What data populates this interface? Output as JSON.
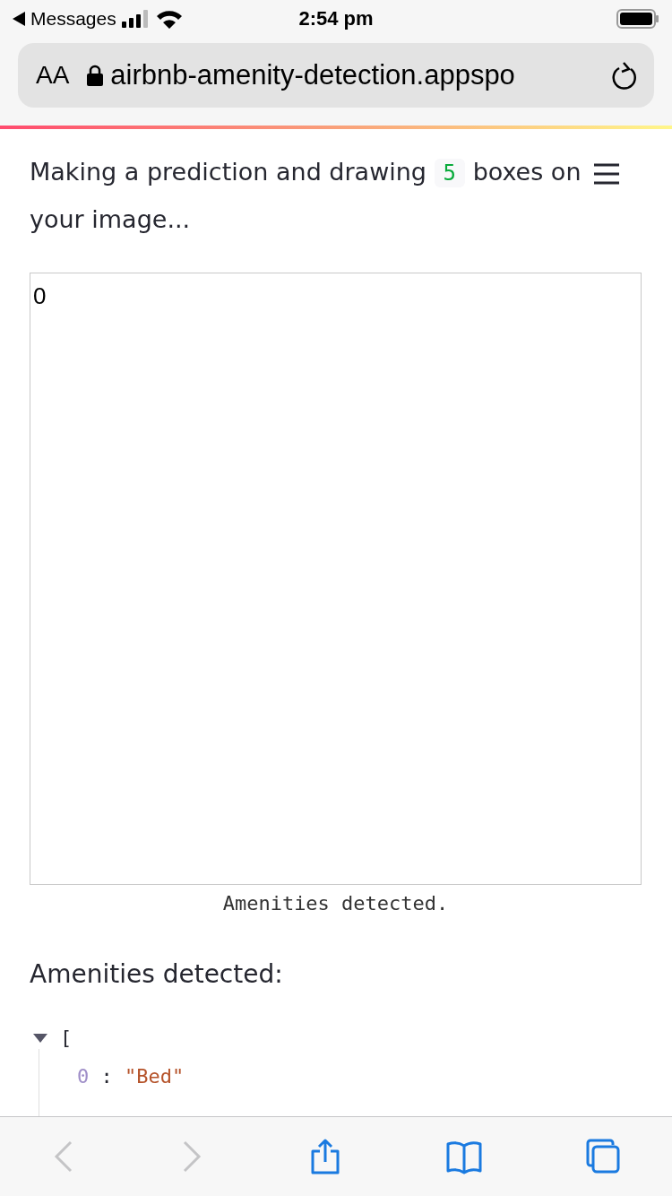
{
  "status_bar": {
    "back_label": "Messages",
    "time": "2:54 pm"
  },
  "address_bar": {
    "text_size": "AA",
    "url": "airbnb-amenity-detection.appspo"
  },
  "content": {
    "message_before": "Making a prediction and drawing",
    "count": "5",
    "message_after": "boxes on your image...",
    "image_label": "0",
    "caption": "Amenities detected.",
    "heading": "Amenities detected:",
    "json_tree": {
      "bracket": "[",
      "expanded": true,
      "items": [
        {
          "index": "0",
          "separator": ":",
          "value": "\"Bed\""
        }
      ]
    }
  },
  "toolbar": {
    "buttons": [
      {
        "kind": "back",
        "disabled": true
      },
      {
        "kind": "forward",
        "disabled": true
      },
      {
        "kind": "share",
        "disabled": false
      },
      {
        "kind": "bookmarks",
        "disabled": false
      },
      {
        "kind": "tabs",
        "disabled": false
      }
    ]
  }
}
